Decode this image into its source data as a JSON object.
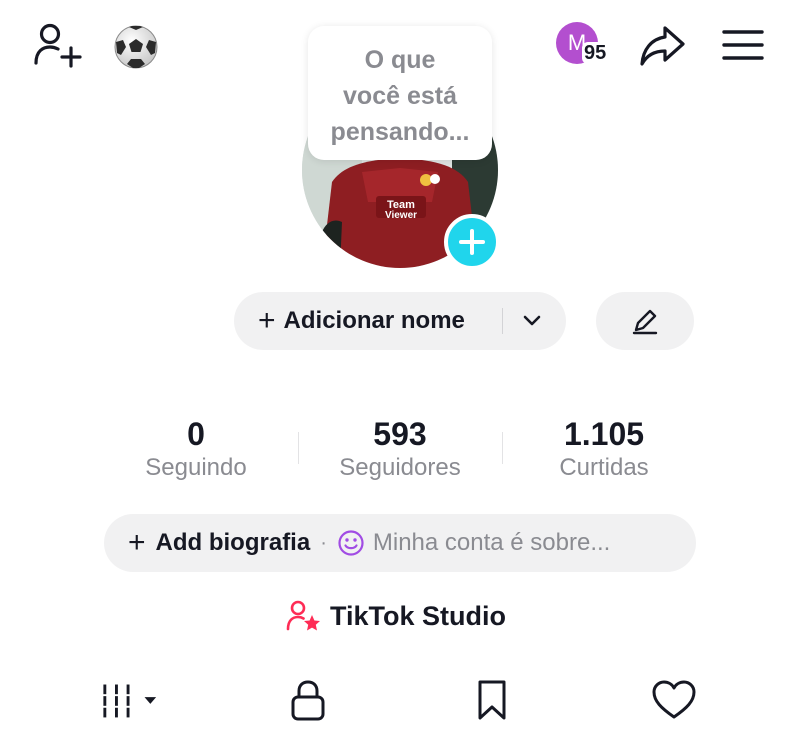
{
  "top_bar": {
    "avatar_initial": "M",
    "notification_count": "95",
    "icons": [
      "add-friend-icon",
      "soccer-ball-icon",
      "share-icon",
      "menu-icon"
    ]
  },
  "profile": {
    "bubble_lines": [
      "O que",
      "você está",
      "pensando..."
    ],
    "add_name_label": "Adicionar nome",
    "plus_glyph": "+"
  },
  "stats": [
    {
      "value": "0",
      "label": "Seguindo"
    },
    {
      "value": "593",
      "label": "Seguidores"
    },
    {
      "value": "1.105",
      "label": "Curtidas"
    }
  ],
  "bio": {
    "add_label": "Add biografia",
    "separator": "·",
    "hint": "Minha conta é sobre..."
  },
  "studio": {
    "label": "TikTok Studio"
  },
  "tabs": [
    "videos-grid-icon",
    "lock-icon",
    "bookmark-icon",
    "heart-icon"
  ],
  "colors": {
    "accent_cyan": "#20d5ec",
    "avatar_purple": "#b34fcf",
    "studio_pink": "#fe2c55",
    "pill_bg": "#f1f1f2",
    "muted_text": "#8a8b91"
  }
}
